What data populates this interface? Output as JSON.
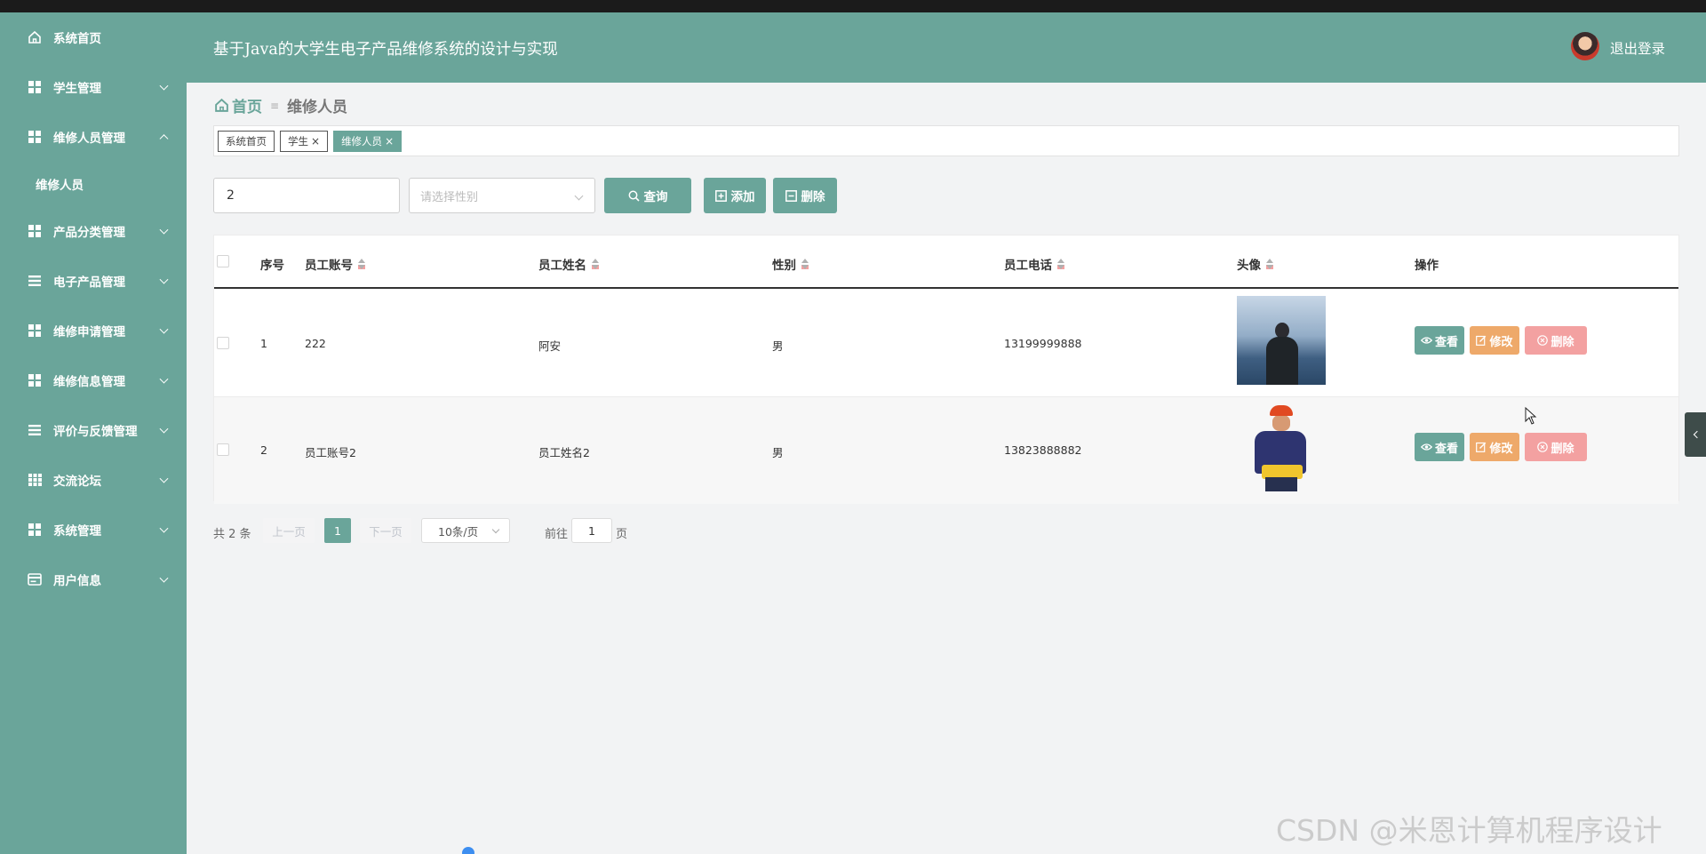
{
  "colors": {
    "primary": "#6aa59a",
    "edit": "#eea96a",
    "delete": "#f3a1a1",
    "background": "#f2f3f4"
  },
  "header": {
    "title": "基于Java的大学生电子产品维修系统的设计与实现",
    "logout": "退出登录",
    "avatar_icon": "user-avatar"
  },
  "sidebar": {
    "items": [
      {
        "label": "系统首页",
        "icon": "home-icon"
      },
      {
        "label": "学生管理",
        "icon": "grid-icon"
      },
      {
        "label": "维修人员管理",
        "icon": "grid-icon",
        "expanded": true
      },
      {
        "label": "产品分类管理",
        "icon": "grid-icon"
      },
      {
        "label": "电子产品管理",
        "icon": "list-icon"
      },
      {
        "label": "维修申请管理",
        "icon": "grid-icon"
      },
      {
        "label": "维修信息管理",
        "icon": "grid-icon"
      },
      {
        "label": "评价与反馈管理",
        "icon": "list-icon"
      },
      {
        "label": "交流论坛",
        "icon": "table-icon"
      },
      {
        "label": "系统管理",
        "icon": "grid-icon"
      },
      {
        "label": "用户信息",
        "icon": "card-icon"
      }
    ],
    "subitem": "维修人员"
  },
  "breadcrumb": {
    "home": "首页",
    "current": "维修人员"
  },
  "tags": [
    {
      "label": "系统首页",
      "closable": false
    },
    {
      "label": "学生",
      "closable": true
    },
    {
      "label": "维修人员",
      "closable": true,
      "active": true
    }
  ],
  "tag_close": "×",
  "search": {
    "value": "2",
    "gender_placeholder": "请选择性别"
  },
  "buttons": {
    "query": "查询",
    "add": "添加",
    "delete": "删除"
  },
  "table": {
    "columns": [
      "序号",
      "员工账号",
      "员工姓名",
      "性别",
      "员工电话",
      "头像",
      "操作"
    ],
    "rows": [
      {
        "index": "1",
        "account": "222",
        "name": "阿安",
        "gender": "男",
        "phone": "13199999888"
      },
      {
        "index": "2",
        "account": "员工账号2",
        "name": "员工姓名2",
        "gender": "男",
        "phone": "13823888882"
      }
    ],
    "actions": {
      "view": "查看",
      "edit": "修改",
      "delete": "删除"
    }
  },
  "pagination": {
    "total": "共 2 条",
    "prev": "上一页",
    "current": "1",
    "next": "下一页",
    "page_size": "10条/页",
    "goto_label": "前往",
    "goto_value": "1",
    "page_suffix": "页"
  },
  "watermark": "CSDN @米恩计算机程序设计"
}
